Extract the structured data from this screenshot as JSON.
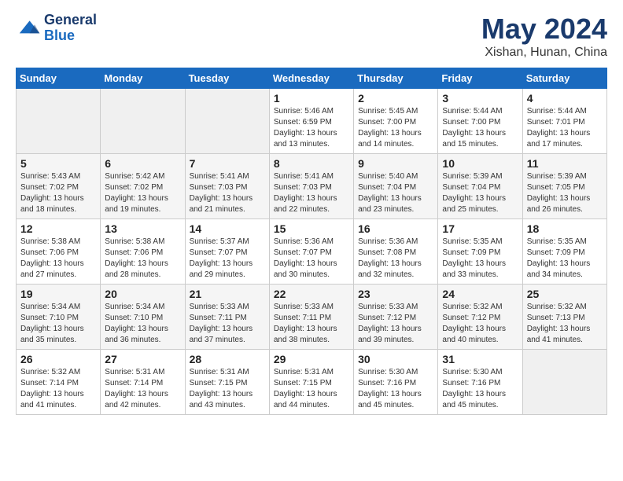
{
  "logo": {
    "line1": "General",
    "line2": "Blue"
  },
  "title": "May 2024",
  "location": "Xishan, Hunan, China",
  "days_of_week": [
    "Sunday",
    "Monday",
    "Tuesday",
    "Wednesday",
    "Thursday",
    "Friday",
    "Saturday"
  ],
  "weeks": [
    [
      {
        "day": "",
        "info": ""
      },
      {
        "day": "",
        "info": ""
      },
      {
        "day": "",
        "info": ""
      },
      {
        "day": "1",
        "info": "Sunrise: 5:46 AM\nSunset: 6:59 PM\nDaylight: 13 hours\nand 13 minutes."
      },
      {
        "day": "2",
        "info": "Sunrise: 5:45 AM\nSunset: 7:00 PM\nDaylight: 13 hours\nand 14 minutes."
      },
      {
        "day": "3",
        "info": "Sunrise: 5:44 AM\nSunset: 7:00 PM\nDaylight: 13 hours\nand 15 minutes."
      },
      {
        "day": "4",
        "info": "Sunrise: 5:44 AM\nSunset: 7:01 PM\nDaylight: 13 hours\nand 17 minutes."
      }
    ],
    [
      {
        "day": "5",
        "info": "Sunrise: 5:43 AM\nSunset: 7:02 PM\nDaylight: 13 hours\nand 18 minutes."
      },
      {
        "day": "6",
        "info": "Sunrise: 5:42 AM\nSunset: 7:02 PM\nDaylight: 13 hours\nand 19 minutes."
      },
      {
        "day": "7",
        "info": "Sunrise: 5:41 AM\nSunset: 7:03 PM\nDaylight: 13 hours\nand 21 minutes."
      },
      {
        "day": "8",
        "info": "Sunrise: 5:41 AM\nSunset: 7:03 PM\nDaylight: 13 hours\nand 22 minutes."
      },
      {
        "day": "9",
        "info": "Sunrise: 5:40 AM\nSunset: 7:04 PM\nDaylight: 13 hours\nand 23 minutes."
      },
      {
        "day": "10",
        "info": "Sunrise: 5:39 AM\nSunset: 7:04 PM\nDaylight: 13 hours\nand 25 minutes."
      },
      {
        "day": "11",
        "info": "Sunrise: 5:39 AM\nSunset: 7:05 PM\nDaylight: 13 hours\nand 26 minutes."
      }
    ],
    [
      {
        "day": "12",
        "info": "Sunrise: 5:38 AM\nSunset: 7:06 PM\nDaylight: 13 hours\nand 27 minutes."
      },
      {
        "day": "13",
        "info": "Sunrise: 5:38 AM\nSunset: 7:06 PM\nDaylight: 13 hours\nand 28 minutes."
      },
      {
        "day": "14",
        "info": "Sunrise: 5:37 AM\nSunset: 7:07 PM\nDaylight: 13 hours\nand 29 minutes."
      },
      {
        "day": "15",
        "info": "Sunrise: 5:36 AM\nSunset: 7:07 PM\nDaylight: 13 hours\nand 30 minutes."
      },
      {
        "day": "16",
        "info": "Sunrise: 5:36 AM\nSunset: 7:08 PM\nDaylight: 13 hours\nand 32 minutes."
      },
      {
        "day": "17",
        "info": "Sunrise: 5:35 AM\nSunset: 7:09 PM\nDaylight: 13 hours\nand 33 minutes."
      },
      {
        "day": "18",
        "info": "Sunrise: 5:35 AM\nSunset: 7:09 PM\nDaylight: 13 hours\nand 34 minutes."
      }
    ],
    [
      {
        "day": "19",
        "info": "Sunrise: 5:34 AM\nSunset: 7:10 PM\nDaylight: 13 hours\nand 35 minutes."
      },
      {
        "day": "20",
        "info": "Sunrise: 5:34 AM\nSunset: 7:10 PM\nDaylight: 13 hours\nand 36 minutes."
      },
      {
        "day": "21",
        "info": "Sunrise: 5:33 AM\nSunset: 7:11 PM\nDaylight: 13 hours\nand 37 minutes."
      },
      {
        "day": "22",
        "info": "Sunrise: 5:33 AM\nSunset: 7:11 PM\nDaylight: 13 hours\nand 38 minutes."
      },
      {
        "day": "23",
        "info": "Sunrise: 5:33 AM\nSunset: 7:12 PM\nDaylight: 13 hours\nand 39 minutes."
      },
      {
        "day": "24",
        "info": "Sunrise: 5:32 AM\nSunset: 7:12 PM\nDaylight: 13 hours\nand 40 minutes."
      },
      {
        "day": "25",
        "info": "Sunrise: 5:32 AM\nSunset: 7:13 PM\nDaylight: 13 hours\nand 41 minutes."
      }
    ],
    [
      {
        "day": "26",
        "info": "Sunrise: 5:32 AM\nSunset: 7:14 PM\nDaylight: 13 hours\nand 41 minutes."
      },
      {
        "day": "27",
        "info": "Sunrise: 5:31 AM\nSunset: 7:14 PM\nDaylight: 13 hours\nand 42 minutes."
      },
      {
        "day": "28",
        "info": "Sunrise: 5:31 AM\nSunset: 7:15 PM\nDaylight: 13 hours\nand 43 minutes."
      },
      {
        "day": "29",
        "info": "Sunrise: 5:31 AM\nSunset: 7:15 PM\nDaylight: 13 hours\nand 44 minutes."
      },
      {
        "day": "30",
        "info": "Sunrise: 5:30 AM\nSunset: 7:16 PM\nDaylight: 13 hours\nand 45 minutes."
      },
      {
        "day": "31",
        "info": "Sunrise: 5:30 AM\nSunset: 7:16 PM\nDaylight: 13 hours\nand 45 minutes."
      },
      {
        "day": "",
        "info": ""
      }
    ]
  ]
}
